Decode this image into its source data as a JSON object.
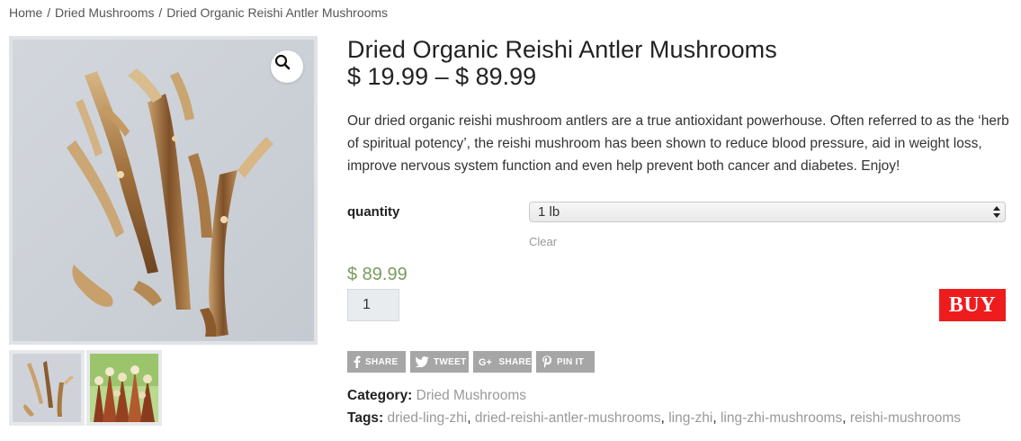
{
  "breadcrumb": {
    "home": "Home",
    "category": "Dried Mushrooms",
    "current": "Dried Organic Reishi Antler Mushrooms",
    "separator": "/"
  },
  "product": {
    "title": "Dried Organic Reishi Antler Mushrooms",
    "price_range": "$ 19.99 – $ 89.99",
    "description": "Our dried organic reishi mushroom antlers are a true antioxidant powerhouse. Often referred to as the ‘herb of spiritual potency’, the reishi mushroom has been shown to reduce blood pressure, aid in weight loss, improve nervous system function and even help prevent both cancer and diabetes. Enjoy!"
  },
  "variation": {
    "label": "quantity",
    "selected": "1 lb",
    "clear_label": "Clear",
    "price": "$ 89.99"
  },
  "cart": {
    "quantity_value": "1",
    "buy_label": "BUY"
  },
  "share": {
    "facebook": "SHARE",
    "twitter": "TWEET",
    "google": "SHARE",
    "pinterest": "PIN IT"
  },
  "meta": {
    "category_label": "Category:",
    "category": "Dried Mushrooms",
    "tags_label": "Tags:",
    "tags": [
      "dried-ling-zhi",
      "dried-reishi-antler-mushrooms",
      "ling-zhi",
      "ling-zhi-mushrooms",
      "reishi-mushrooms"
    ],
    "tag_separator": ","
  },
  "icons": {
    "zoom": "magnifier-icon",
    "select_arrows": "updown-arrows-icon",
    "facebook": "facebook-icon",
    "twitter": "twitter-icon",
    "google": "google-plus-icon",
    "pinterest": "pinterest-icon"
  },
  "colors": {
    "buy_button": "#ee1c1c",
    "variant_price": "#7a9c5f",
    "share_button": "#a6a6a6",
    "meta_link": "#999999"
  }
}
